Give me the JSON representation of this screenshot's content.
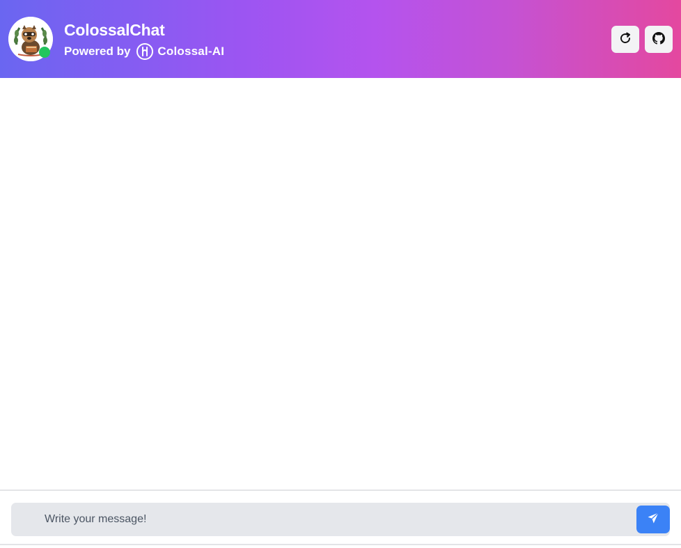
{
  "app": {
    "title": "ColossalChat",
    "powered_by_label": "Powered by",
    "brand_name": "Colossal-AI"
  },
  "header": {
    "avatar_icon": "raccoon-avatar-icon",
    "status": "online",
    "status_color": "#22c55e",
    "gradient_colors": [
      "#6a66f1",
      "#b453ee",
      "#e4489f"
    ],
    "buttons": [
      {
        "name": "refresh-button",
        "icon": "refresh-icon"
      },
      {
        "name": "github-button",
        "icon": "github-icon"
      }
    ]
  },
  "composer": {
    "placeholder": "Write your message!",
    "value": "",
    "send_icon": "paper-plane-icon",
    "send_color": "#3b82f6"
  }
}
